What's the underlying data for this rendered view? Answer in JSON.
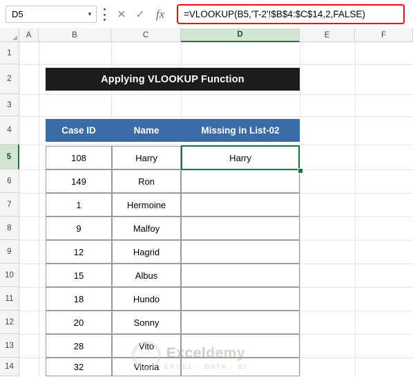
{
  "formula_bar": {
    "name_box_value": "D5",
    "name_box_placeholder": "Name Box",
    "dropdown_icon": "chevron-down-icon",
    "kebab_icon": "more-options-icon",
    "cancel_icon": "✕",
    "enter_icon": "✓",
    "fx_icon": "fx",
    "formula_value": "=VLOOKUP(B5,'T-2'!$B$4:$C$14,2,FALSE)",
    "highlight_color": "#ff0000"
  },
  "grid": {
    "column_headers": [
      "A",
      "B",
      "C",
      "D",
      "E",
      "F"
    ],
    "row_headers": [
      "1",
      "2",
      "3",
      "4",
      "5",
      "6",
      "7",
      "8",
      "9",
      "10",
      "11",
      "12",
      "13",
      "14"
    ],
    "selected_column": "D",
    "selected_row": "5",
    "header_accent": "#217346"
  },
  "sheet": {
    "title": "Applying VLOOKUP Function",
    "title_bg": "#1c1c1c",
    "table_header_bg": "#3b6ca8",
    "columns": [
      "Case ID",
      "Name",
      "Missing in List-02"
    ],
    "rows": [
      {
        "case_id": "108",
        "name": "Harry",
        "missing": "Harry"
      },
      {
        "case_id": "149",
        "name": "Ron",
        "missing": ""
      },
      {
        "case_id": "1",
        "name": "Hermoine",
        "missing": ""
      },
      {
        "case_id": "9",
        "name": "Malfoy",
        "missing": ""
      },
      {
        "case_id": "12",
        "name": "Hagrid",
        "missing": ""
      },
      {
        "case_id": "15",
        "name": "Albus",
        "missing": ""
      },
      {
        "case_id": "18",
        "name": "Hundo",
        "missing": ""
      },
      {
        "case_id": "20",
        "name": "Sonny",
        "missing": ""
      },
      {
        "case_id": "28",
        "name": "Vito",
        "missing": ""
      },
      {
        "case_id": "32",
        "name": "Vitoria",
        "missing": ""
      }
    ]
  },
  "watermark": {
    "main_prefix": "Excel",
    "main_suffix": "demy",
    "sub": "EXCEL · DATA · BI"
  }
}
